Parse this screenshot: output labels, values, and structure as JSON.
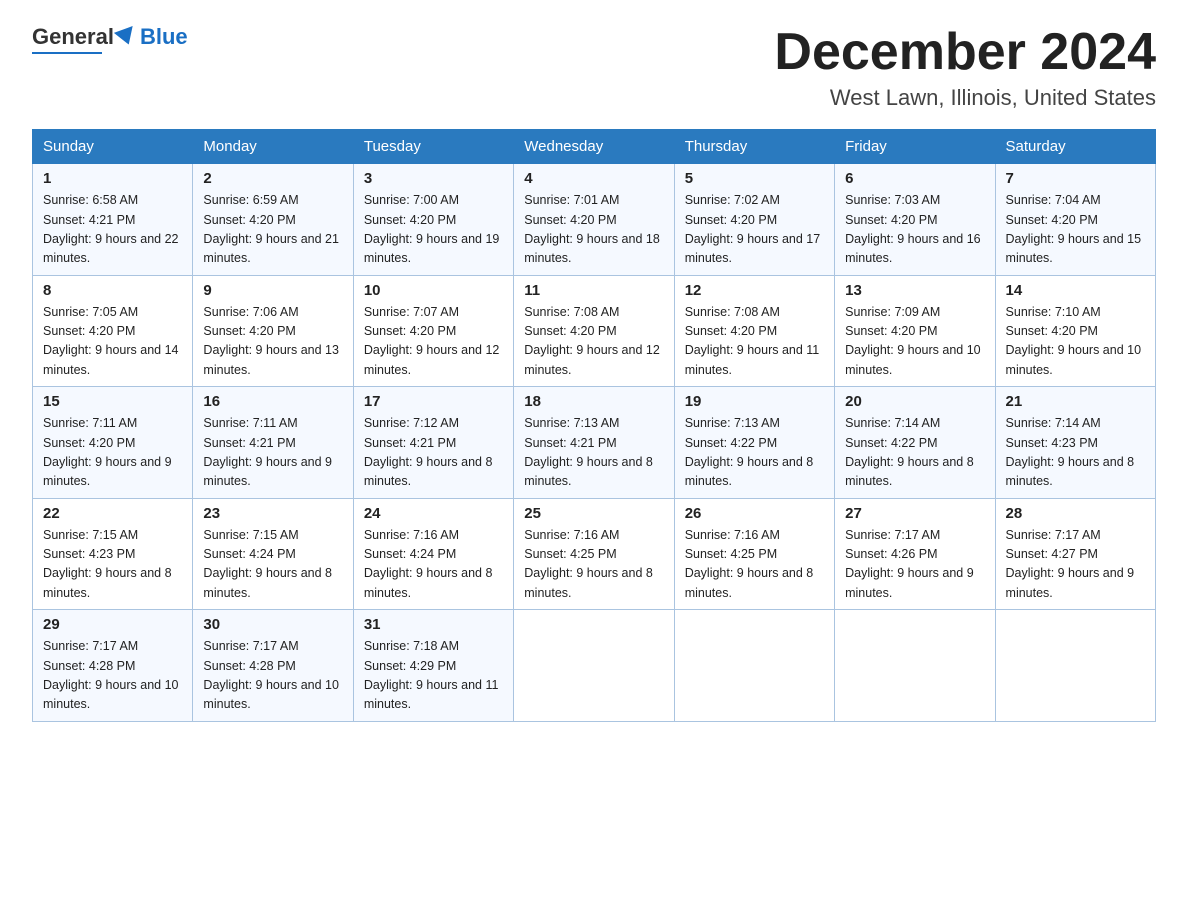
{
  "header": {
    "logo_general": "General",
    "logo_blue": "Blue",
    "month_title": "December 2024",
    "location": "West Lawn, Illinois, United States"
  },
  "days_of_week": [
    "Sunday",
    "Monday",
    "Tuesday",
    "Wednesday",
    "Thursday",
    "Friday",
    "Saturday"
  ],
  "weeks": [
    [
      {
        "day": "1",
        "sunrise": "Sunrise: 6:58 AM",
        "sunset": "Sunset: 4:21 PM",
        "daylight": "Daylight: 9 hours and 22 minutes."
      },
      {
        "day": "2",
        "sunrise": "Sunrise: 6:59 AM",
        "sunset": "Sunset: 4:20 PM",
        "daylight": "Daylight: 9 hours and 21 minutes."
      },
      {
        "day": "3",
        "sunrise": "Sunrise: 7:00 AM",
        "sunset": "Sunset: 4:20 PM",
        "daylight": "Daylight: 9 hours and 19 minutes."
      },
      {
        "day": "4",
        "sunrise": "Sunrise: 7:01 AM",
        "sunset": "Sunset: 4:20 PM",
        "daylight": "Daylight: 9 hours and 18 minutes."
      },
      {
        "day": "5",
        "sunrise": "Sunrise: 7:02 AM",
        "sunset": "Sunset: 4:20 PM",
        "daylight": "Daylight: 9 hours and 17 minutes."
      },
      {
        "day": "6",
        "sunrise": "Sunrise: 7:03 AM",
        "sunset": "Sunset: 4:20 PM",
        "daylight": "Daylight: 9 hours and 16 minutes."
      },
      {
        "day": "7",
        "sunrise": "Sunrise: 7:04 AM",
        "sunset": "Sunset: 4:20 PM",
        "daylight": "Daylight: 9 hours and 15 minutes."
      }
    ],
    [
      {
        "day": "8",
        "sunrise": "Sunrise: 7:05 AM",
        "sunset": "Sunset: 4:20 PM",
        "daylight": "Daylight: 9 hours and 14 minutes."
      },
      {
        "day": "9",
        "sunrise": "Sunrise: 7:06 AM",
        "sunset": "Sunset: 4:20 PM",
        "daylight": "Daylight: 9 hours and 13 minutes."
      },
      {
        "day": "10",
        "sunrise": "Sunrise: 7:07 AM",
        "sunset": "Sunset: 4:20 PM",
        "daylight": "Daylight: 9 hours and 12 minutes."
      },
      {
        "day": "11",
        "sunrise": "Sunrise: 7:08 AM",
        "sunset": "Sunset: 4:20 PM",
        "daylight": "Daylight: 9 hours and 12 minutes."
      },
      {
        "day": "12",
        "sunrise": "Sunrise: 7:08 AM",
        "sunset": "Sunset: 4:20 PM",
        "daylight": "Daylight: 9 hours and 11 minutes."
      },
      {
        "day": "13",
        "sunrise": "Sunrise: 7:09 AM",
        "sunset": "Sunset: 4:20 PM",
        "daylight": "Daylight: 9 hours and 10 minutes."
      },
      {
        "day": "14",
        "sunrise": "Sunrise: 7:10 AM",
        "sunset": "Sunset: 4:20 PM",
        "daylight": "Daylight: 9 hours and 10 minutes."
      }
    ],
    [
      {
        "day": "15",
        "sunrise": "Sunrise: 7:11 AM",
        "sunset": "Sunset: 4:20 PM",
        "daylight": "Daylight: 9 hours and 9 minutes."
      },
      {
        "day": "16",
        "sunrise": "Sunrise: 7:11 AM",
        "sunset": "Sunset: 4:21 PM",
        "daylight": "Daylight: 9 hours and 9 minutes."
      },
      {
        "day": "17",
        "sunrise": "Sunrise: 7:12 AM",
        "sunset": "Sunset: 4:21 PM",
        "daylight": "Daylight: 9 hours and 8 minutes."
      },
      {
        "day": "18",
        "sunrise": "Sunrise: 7:13 AM",
        "sunset": "Sunset: 4:21 PM",
        "daylight": "Daylight: 9 hours and 8 minutes."
      },
      {
        "day": "19",
        "sunrise": "Sunrise: 7:13 AM",
        "sunset": "Sunset: 4:22 PM",
        "daylight": "Daylight: 9 hours and 8 minutes."
      },
      {
        "day": "20",
        "sunrise": "Sunrise: 7:14 AM",
        "sunset": "Sunset: 4:22 PM",
        "daylight": "Daylight: 9 hours and 8 minutes."
      },
      {
        "day": "21",
        "sunrise": "Sunrise: 7:14 AM",
        "sunset": "Sunset: 4:23 PM",
        "daylight": "Daylight: 9 hours and 8 minutes."
      }
    ],
    [
      {
        "day": "22",
        "sunrise": "Sunrise: 7:15 AM",
        "sunset": "Sunset: 4:23 PM",
        "daylight": "Daylight: 9 hours and 8 minutes."
      },
      {
        "day": "23",
        "sunrise": "Sunrise: 7:15 AM",
        "sunset": "Sunset: 4:24 PM",
        "daylight": "Daylight: 9 hours and 8 minutes."
      },
      {
        "day": "24",
        "sunrise": "Sunrise: 7:16 AM",
        "sunset": "Sunset: 4:24 PM",
        "daylight": "Daylight: 9 hours and 8 minutes."
      },
      {
        "day": "25",
        "sunrise": "Sunrise: 7:16 AM",
        "sunset": "Sunset: 4:25 PM",
        "daylight": "Daylight: 9 hours and 8 minutes."
      },
      {
        "day": "26",
        "sunrise": "Sunrise: 7:16 AM",
        "sunset": "Sunset: 4:25 PM",
        "daylight": "Daylight: 9 hours and 8 minutes."
      },
      {
        "day": "27",
        "sunrise": "Sunrise: 7:17 AM",
        "sunset": "Sunset: 4:26 PM",
        "daylight": "Daylight: 9 hours and 9 minutes."
      },
      {
        "day": "28",
        "sunrise": "Sunrise: 7:17 AM",
        "sunset": "Sunset: 4:27 PM",
        "daylight": "Daylight: 9 hours and 9 minutes."
      }
    ],
    [
      {
        "day": "29",
        "sunrise": "Sunrise: 7:17 AM",
        "sunset": "Sunset: 4:28 PM",
        "daylight": "Daylight: 9 hours and 10 minutes."
      },
      {
        "day": "30",
        "sunrise": "Sunrise: 7:17 AM",
        "sunset": "Sunset: 4:28 PM",
        "daylight": "Daylight: 9 hours and 10 minutes."
      },
      {
        "day": "31",
        "sunrise": "Sunrise: 7:18 AM",
        "sunset": "Sunset: 4:29 PM",
        "daylight": "Daylight: 9 hours and 11 minutes."
      },
      null,
      null,
      null,
      null
    ]
  ]
}
